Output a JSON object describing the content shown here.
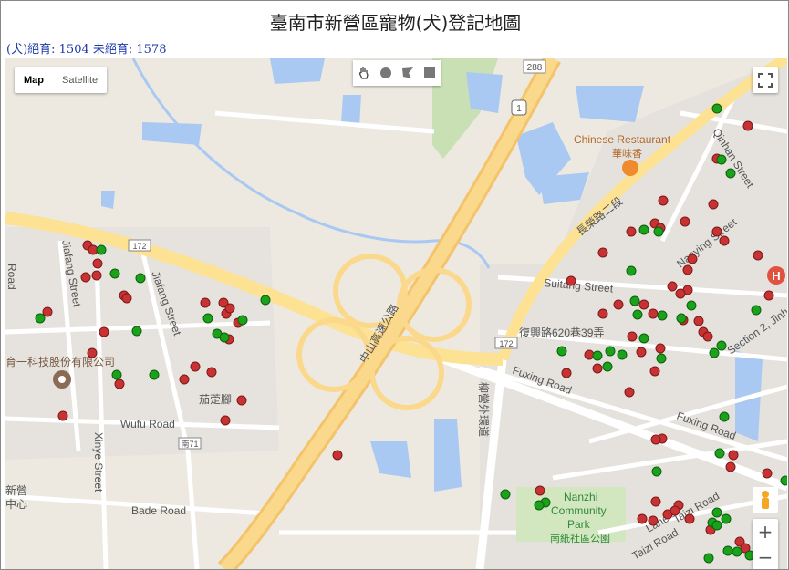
{
  "page": {
    "title": "臺南市新營區寵物(犬)登記地圖",
    "stats": "(犬)絕育: 1504 未絕育: 1578"
  },
  "map_controls": {
    "map_label": "Map",
    "satellite_label": "Satellite",
    "active_type": "Map",
    "draw_tools": [
      "hand-icon",
      "circle-icon",
      "polygon-icon",
      "rectangle-icon"
    ],
    "zoom_in": "+",
    "zoom_out": "−"
  },
  "colors": {
    "sterilized": "#1aa31a",
    "not_sterilized": "#c83232"
  },
  "map_labels": {
    "highway_shield": "288",
    "route_shield": "1",
    "r172_left": "172",
    "r172_right": "172",
    "south71": "南71",
    "chinese_restaurant": "Chinese Restaurant",
    "restaurant_cn": "華味香",
    "changrong": "長榮路二段",
    "qinhan": "Qinhan Street",
    "nanying": "Nanying Street",
    "suitang": "Suitang Street",
    "fuxing620": "復興路620巷39弄",
    "section2": "Section 2, Jinh",
    "fuxing_road": "Fuxing Road",
    "fuxing_road2": "Fuxing Road",
    "zhongshan_fwy": "中山高速公路",
    "liuying": "柳營外環道",
    "jiafang": "Jiafang Street",
    "jiafang2": "Jiafang Street",
    "rd_left": "Road",
    "company": "育一科技股份有限公司",
    "jiaqi": "茄萣腳",
    "wufu": "Wufu Road",
    "xinye": "Xinye Street",
    "bade": "Bade Road",
    "xinying_a": "新營",
    "xinying_b": "中心",
    "nanzhi1": "Nanzhi",
    "nanzhi2": "Community",
    "nanzhi3": "Park",
    "nanzhi_cn": "南紙社區公園",
    "taizi": "Taizi Road",
    "taizi2": "Taizi Road",
    "lane": "Lane"
  }
}
